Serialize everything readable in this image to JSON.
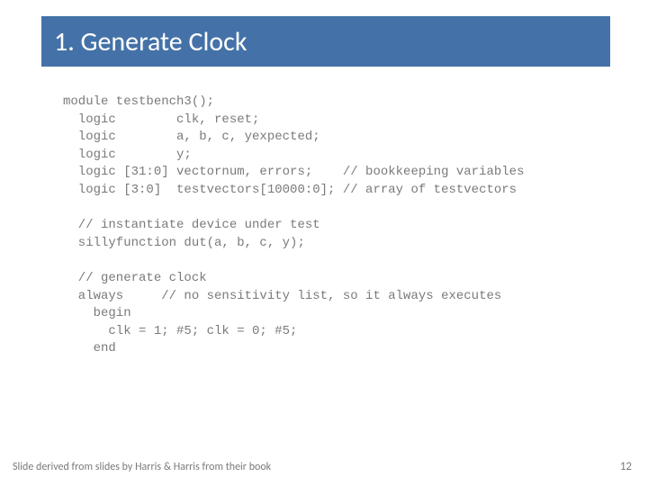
{
  "title": "1. Generate Clock",
  "code": "module testbench3();\n  logic        clk, reset;\n  logic        a, b, c, yexpected;\n  logic        y;\n  logic [31:0] vectornum, errors;    // bookkeeping variables\n  logic [3:0]  testvectors[10000:0]; // array of testvectors\n\n  // instantiate device under test\n  sillyfunction dut(a, b, c, y);\n\n  // generate clock\n  always     // no sensitivity list, so it always executes\n    begin\n      clk = 1; #5; clk = 0; #5;\n    end",
  "footer_left": "Slide derived from slides by Harris & Harris from their book",
  "footer_right": "12"
}
